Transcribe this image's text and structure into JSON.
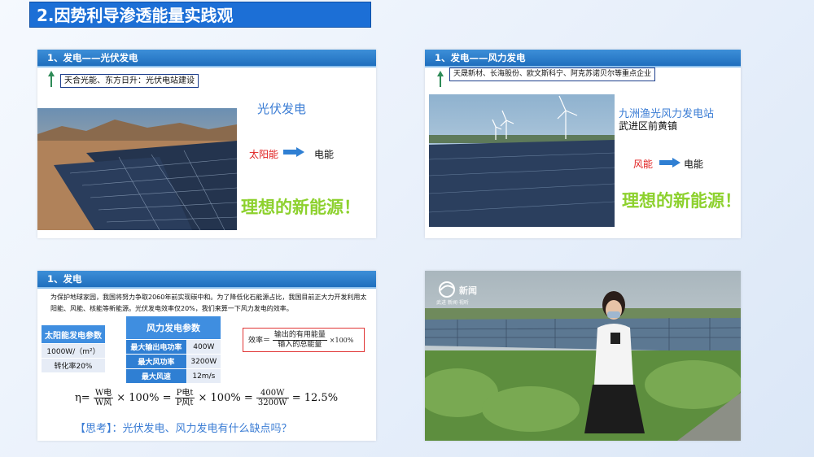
{
  "title": "2.因势利导渗透能量实践观",
  "panel1": {
    "header": "1、发电——光伏发电",
    "companies": "天合光能、东方日升：光伏电站建设",
    "type_label": "光伏发电",
    "source": "太阳能",
    "target": "电能",
    "slogan": "理想的新能源！"
  },
  "panel2": {
    "header": "1、发电——风力发电",
    "companies": "天晟新材、长海股份、欧文斯科宁、阿克苏诺贝尔等重点企业",
    "station": "九洲渔光风力发电站",
    "location": "武进区前黄镇",
    "source": "风能",
    "target": "电能",
    "slogan": "理想的新能源！"
  },
  "panel3": {
    "header": "1、发电",
    "paragraph": "为保护地球家园，我国将努力争取2060年前实现碳中和。为了降低化石能源占比，我国目前正大力开发利用太阳能、风能、核能等新能源。光伏发电效率仅20%，我们来算一下风力发电的效率。",
    "solar_table": {
      "header": "太阳能发电参数",
      "rows": [
        "1000W/（m²）",
        "转化率20%"
      ]
    },
    "wind_table": {
      "header": "风力发电参数",
      "rows": [
        {
          "label": "最大输出电功率",
          "value": "400W"
        },
        {
          "label": "最大风功率",
          "value": "3200W"
        },
        {
          "label": "最大风速",
          "value": "12m/s"
        }
      ]
    },
    "efficiency": {
      "lhs": "效率＝",
      "numerator": "输出的有用能量",
      "denominator": "输入的总能量",
      "factor": "×100%"
    },
    "calc": {
      "eta": "η=",
      "w_num": "W电",
      "w_den": "W风",
      "times1": "× 100% =",
      "p_num": "P电t",
      "p_den": "P风t",
      "times2": "× 100% =",
      "v_num": "400W",
      "v_den": "3200W",
      "result": "= 12.5%"
    },
    "think": "【思考】：光伏发电、风力发电有什么缺点吗？"
  },
  "panel4": {
    "logo_text": "新闻",
    "logo_sub": "武进  新闻·视听"
  },
  "colors": {
    "title_bg": "#1c6fd6",
    "header_bg": "#1f6fbe",
    "slogan": "#8dd12e",
    "accent_blue": "#3a7cd4",
    "red": "#e02020"
  }
}
